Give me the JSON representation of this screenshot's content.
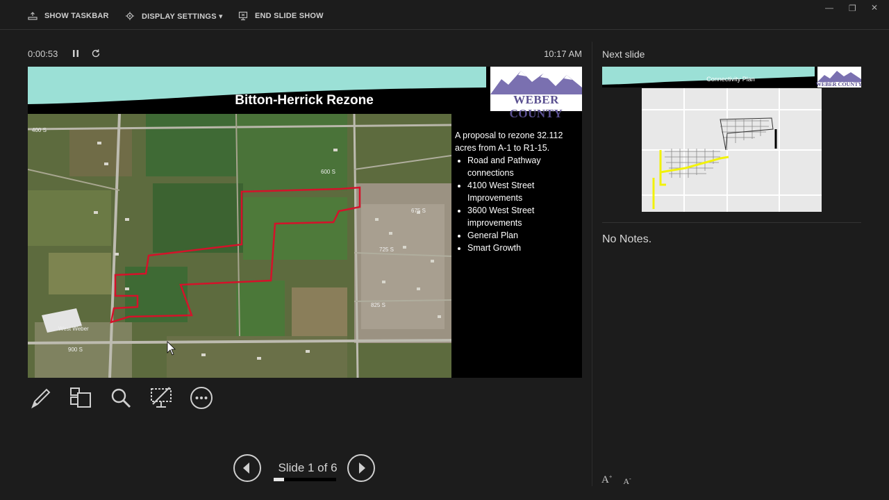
{
  "toolbar": {
    "show_taskbar": "SHOW TASKBAR",
    "display_settings": "DISPLAY SETTINGS ▾",
    "end_slide_show": "END SLIDE SHOW"
  },
  "presenter": {
    "elapsed": "0:00:53",
    "clock": "10:17 AM",
    "slide_counter": "Slide 1 of 6",
    "progress": 0.17
  },
  "slide": {
    "title": "Bitton-Herrick Rezone",
    "logo_text": "WEBER COUNTY",
    "intro": "A proposal to rezone 32.112 acres from A-1 to R1-15.",
    "bullets": [
      "Road and Pathway connections",
      "4100 West Street Improvements",
      "3600 West Street improvements",
      "General Plan",
      "Smart Growth"
    ],
    "map_labels": [
      "400 S",
      "600 S",
      "675 S",
      "725 S",
      "825 S",
      "900 S",
      "West Weber"
    ]
  },
  "next": {
    "label": "Next slide",
    "title": "Connectivity Plan",
    "logo_text": "WEBER COUNTY"
  },
  "notes": "No Notes.",
  "colors": {
    "teal": "#9be0d6",
    "boundary": "#d4122a",
    "pathway": "#f2f20a"
  },
  "icons": {
    "pen": "pen-icon",
    "slides": "see-all-slides-icon",
    "zoom": "zoom-icon",
    "black": "black-screen-icon",
    "more": "more-options-icon"
  }
}
